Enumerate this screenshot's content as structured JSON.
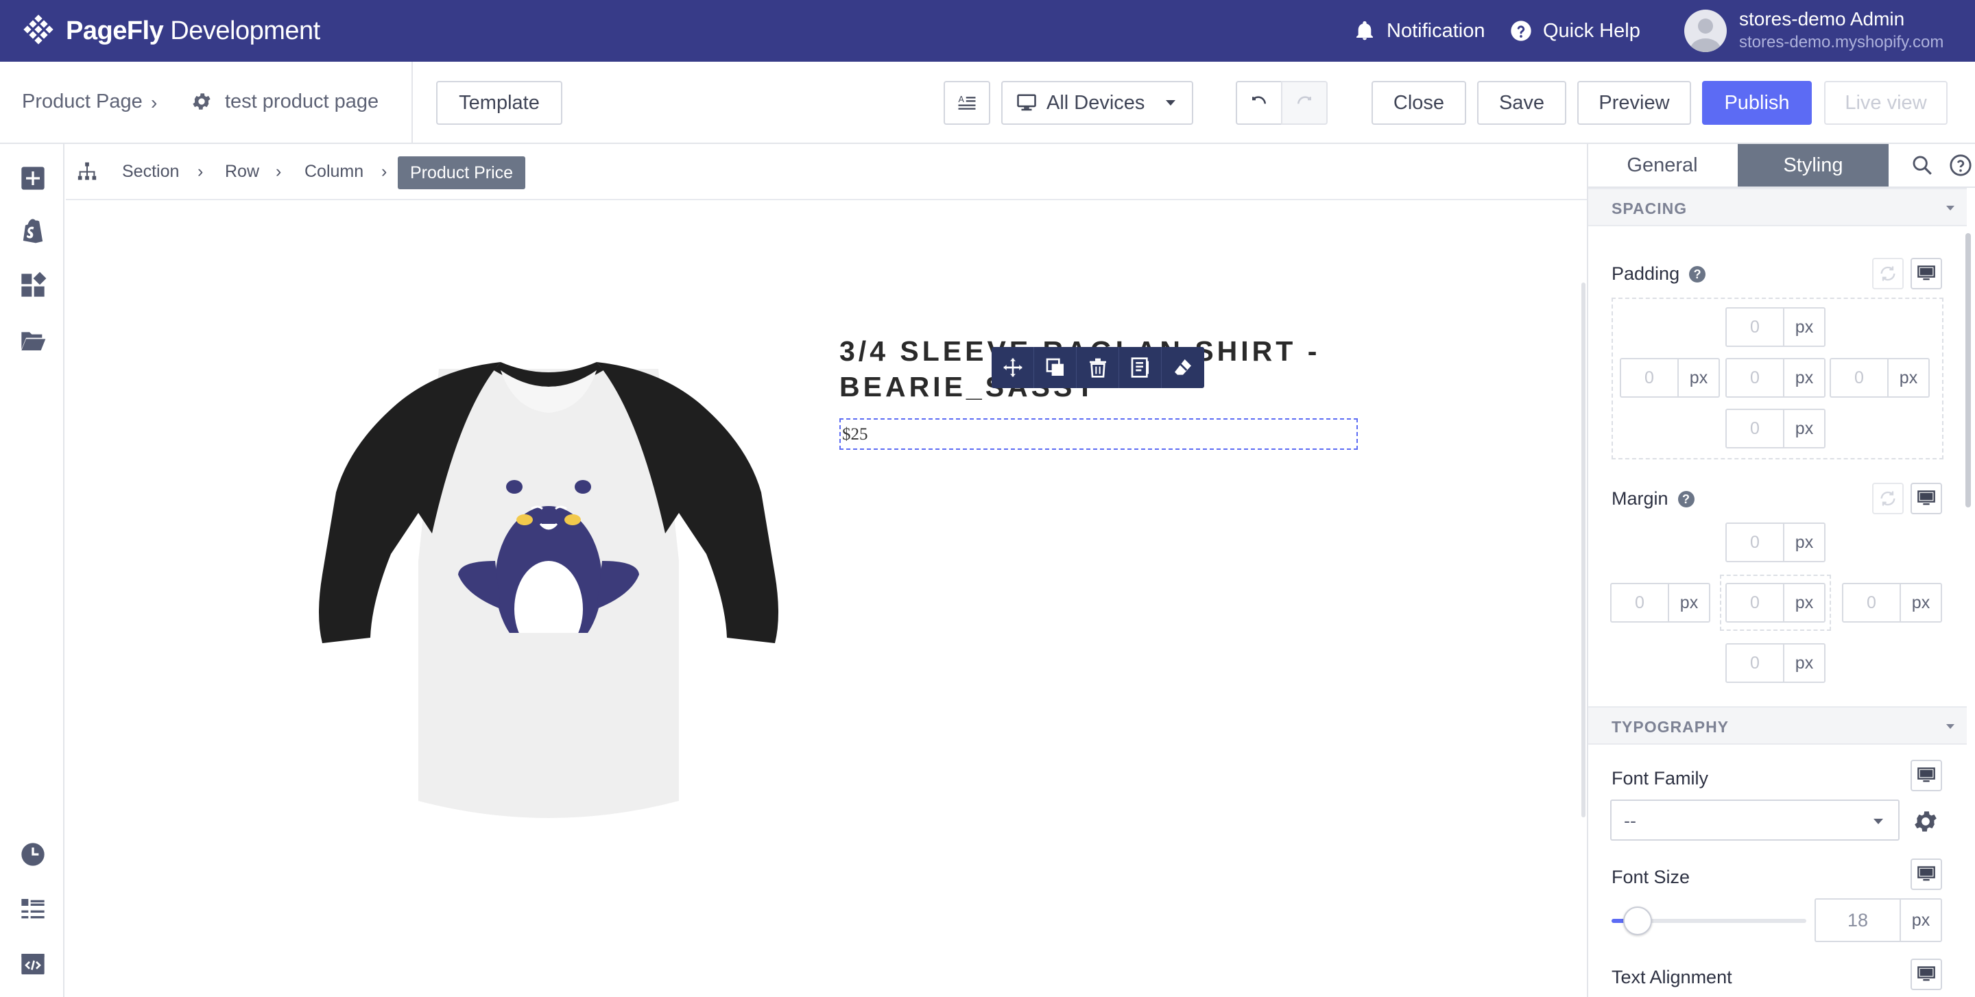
{
  "topbar": {
    "brand_bold": "PageFly",
    "brand_rest": " Development",
    "notification_label": "Notification",
    "quick_help_label": "Quick Help",
    "user_name": "stores-demo Admin",
    "user_store": "stores-demo.myshopify.com",
    "background_color": "#373b88"
  },
  "toolbar": {
    "breadcrumb": [
      "Product Page",
      "test product page"
    ],
    "template_label": "Template",
    "device_select_value": "All Devices",
    "close_label": "Close",
    "save_label": "Save",
    "preview_label": "Preview",
    "publish_label": "Publish",
    "live_view_label": "Live view",
    "accent_color": "#5c6bf4"
  },
  "leftrail": {
    "icons": [
      "add-element-icon",
      "shopify-icon",
      "elements-grid-icon",
      "folder-icon",
      "history-icon",
      "layers-list-icon",
      "code-icon"
    ]
  },
  "element_breadcrumb": {
    "items": [
      "Section",
      "Row",
      "Column"
    ],
    "active": "Product Price"
  },
  "canvas": {
    "product_title": "3/4 SLEEVE RAGLAN SHIRT - BEARIE_SASSY",
    "price": "$25",
    "floating_tools": [
      "move-icon",
      "duplicate-icon",
      "delete-icon",
      "save-snippet-icon",
      "eraser-icon"
    ]
  },
  "right_panel": {
    "tabs": [
      "General",
      "Styling"
    ],
    "active_tab": "Styling",
    "spacing": {
      "title": "SPACING",
      "padding_label": "Padding",
      "margin_label": "Margin",
      "value": "0",
      "unit": "px"
    },
    "typography": {
      "title": "TYPOGRAPHY",
      "font_family_label": "Font Family",
      "font_family_value": "--",
      "font_size_label": "Font Size",
      "font_size_value": "18",
      "font_size_unit": "px",
      "font_size_slider_fraction": 0.07,
      "text_alignment_label": "Text Alignment"
    }
  }
}
